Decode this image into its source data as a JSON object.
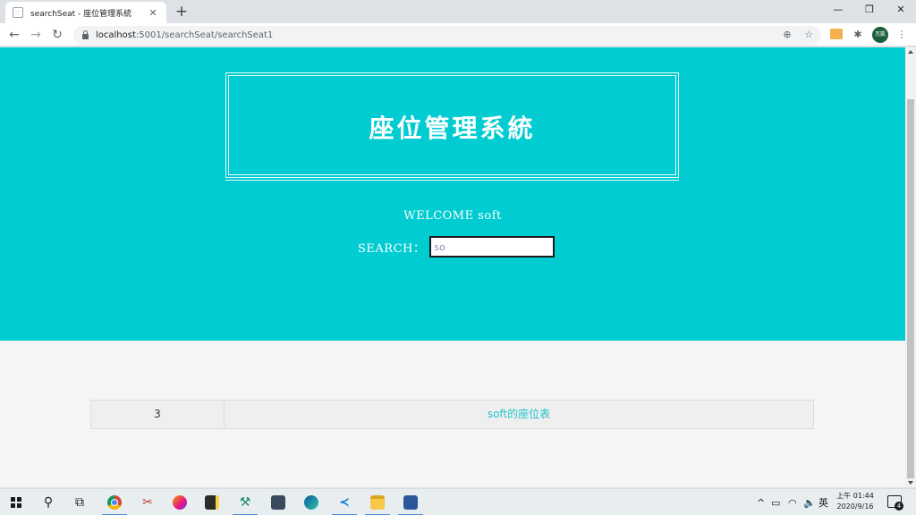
{
  "browser": {
    "tab_title": "searchSeat - 座位管理系統",
    "tab_close": "✕",
    "new_tab": "+",
    "url_host": "localhost",
    "url_rest": ":5001/searchSeat/searchSeat1",
    "profile_label": "杰凱",
    "window_controls": {
      "minimize": "—",
      "restore": "❐",
      "close": "✕"
    }
  },
  "page": {
    "site_title": "座位管理系統",
    "welcome_text": "WELCOME soft",
    "search_label": "SEARCH：",
    "search_value": "so",
    "results": [
      {
        "count": "3",
        "link_text": "soft的座位表"
      }
    ],
    "colors": {
      "hero": "#00ccd1",
      "link": "#22c3c9",
      "page_bg": "#f5f5f5"
    }
  },
  "taskbar": {
    "apps": [
      "start-icon",
      "search-icon",
      "task-view-icon",
      "chrome-icon",
      "snip-icon",
      "firefox-icon",
      "sticky-notes-icon",
      "tools-icon",
      "calculator-icon",
      "edge-icon",
      "vscode-icon",
      "file-explorer-icon",
      "word-icon"
    ],
    "ime_label": "英",
    "clock_time": "上午 01:44",
    "clock_date": "2020/9/16",
    "notification_count": "4"
  }
}
